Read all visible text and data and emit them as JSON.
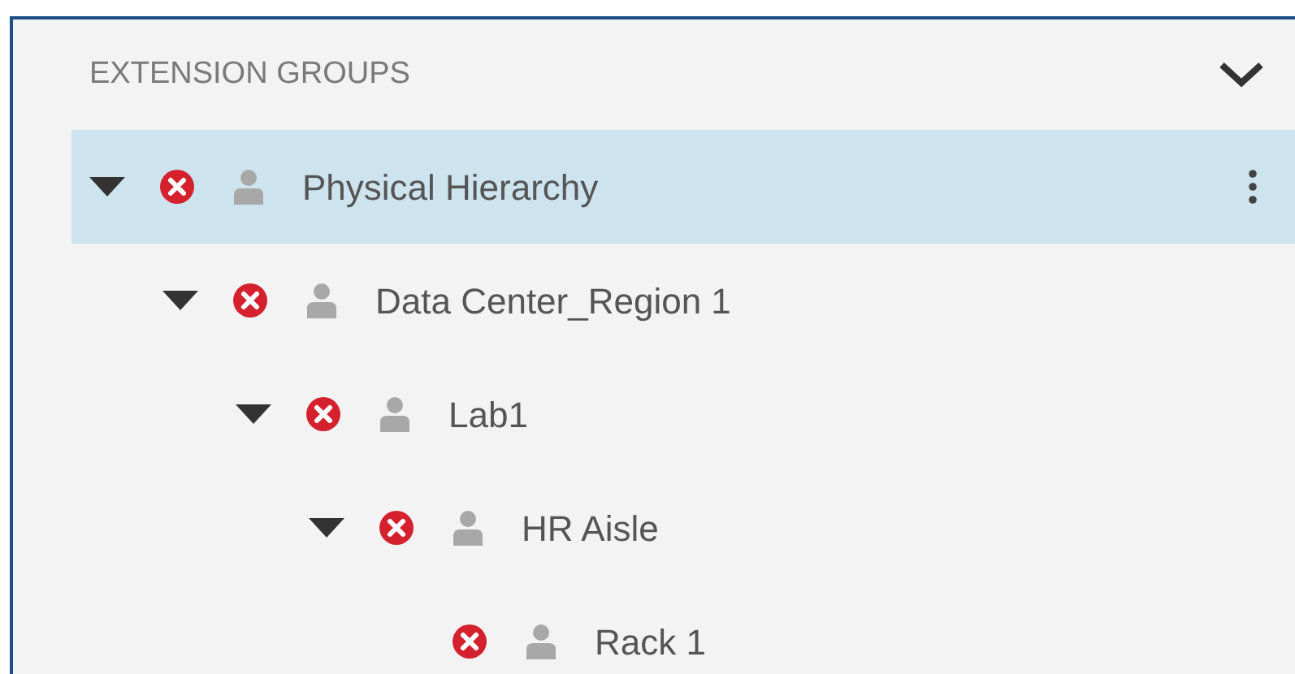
{
  "panel": {
    "title": "EXTENSION GROUPS",
    "collapsed": false
  },
  "tree": [
    {
      "label": "Physical Hierarchy",
      "selected": true,
      "expanded": true,
      "children": [
        {
          "label": "Data Center_Region 1",
          "selected": false,
          "expanded": true,
          "children": [
            {
              "label": "Lab1",
              "selected": false,
              "expanded": true,
              "children": [
                {
                  "label": "HR Aisle",
                  "selected": false,
                  "expanded": true,
                  "children": [
                    {
                      "label": "Rack 1",
                      "selected": false
                    }
                  ]
                }
              ]
            }
          ]
        }
      ]
    }
  ]
}
